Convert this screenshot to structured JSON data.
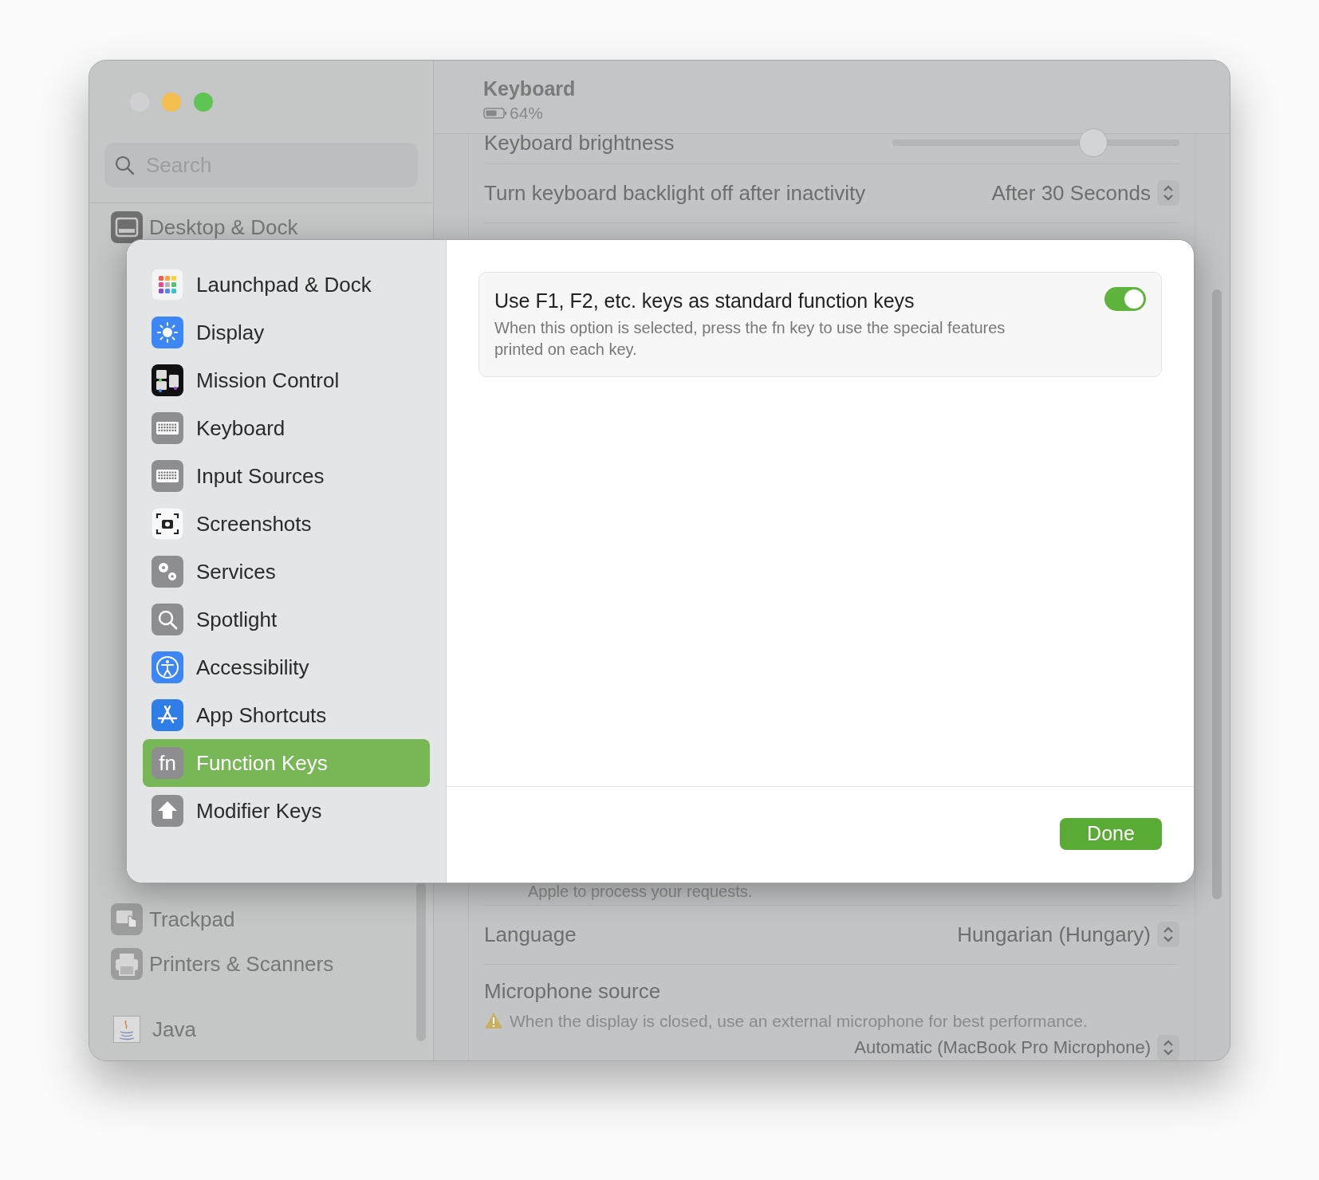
{
  "window": {
    "controls": [
      {
        "color": "#d0d0d2"
      },
      {
        "color": "#f5bf4f"
      },
      {
        "color": "#5fc454"
      }
    ]
  },
  "sidebar": {
    "search": {
      "placeholder": "Search"
    },
    "items_top": [
      {
        "label": "Desktop & Dock",
        "kind": "desktop"
      }
    ],
    "items_bottom": [
      {
        "label": "Trackpad",
        "kind": "trackpad"
      },
      {
        "label": "Printers & Scanners",
        "kind": "printer"
      },
      {
        "label": "Java",
        "kind": "java"
      }
    ]
  },
  "header": {
    "title": "Keyboard",
    "battery": "64%"
  },
  "settings_top": [
    {
      "kind": "slider",
      "label": "Keyboard brightness",
      "level": 0.7
    },
    {
      "kind": "popup",
      "label": "Turn keyboard backlight off after inactivity",
      "value": "After 30 Seconds"
    }
  ],
  "settings_bottom": [
    {
      "kind": "note",
      "text": "Apple to process your requests."
    },
    {
      "kind": "popup",
      "label": "Language",
      "value": "Hungarian (Hungary)"
    },
    {
      "kind": "warning",
      "label": "Microphone source",
      "warning": "When the display is closed, use an external microphone for best performance.",
      "value": "Automatic (MacBook Pro Microphone)"
    }
  ],
  "dialog": {
    "sidebar": [
      {
        "label": "Launchpad & Dock",
        "kind": "launchpad",
        "selected": false
      },
      {
        "label": "Display",
        "kind": "display",
        "selected": false
      },
      {
        "label": "Mission Control",
        "kind": "mission",
        "selected": false
      },
      {
        "label": "Keyboard",
        "kind": "keyboard",
        "selected": false
      },
      {
        "label": "Input Sources",
        "kind": "keyboard",
        "selected": false
      },
      {
        "label": "Screenshots",
        "kind": "screenshot",
        "selected": false
      },
      {
        "label": "Services",
        "kind": "gears",
        "selected": false
      },
      {
        "label": "Spotlight",
        "kind": "search",
        "selected": false
      },
      {
        "label": "Accessibility",
        "kind": "accessibility",
        "selected": false
      },
      {
        "label": "App Shortcuts",
        "kind": "appstore",
        "selected": false
      },
      {
        "label": "Function Keys",
        "kind": "fn",
        "icon_text": "fn",
        "selected": true
      },
      {
        "label": "Modifier Keys",
        "kind": "shift",
        "selected": false
      }
    ],
    "option": {
      "title": "Use F1, F2, etc. keys as standard function keys",
      "description": "When this option is selected, press the fn key to use the special features printed on each key.",
      "on": true
    },
    "done": "Done"
  }
}
